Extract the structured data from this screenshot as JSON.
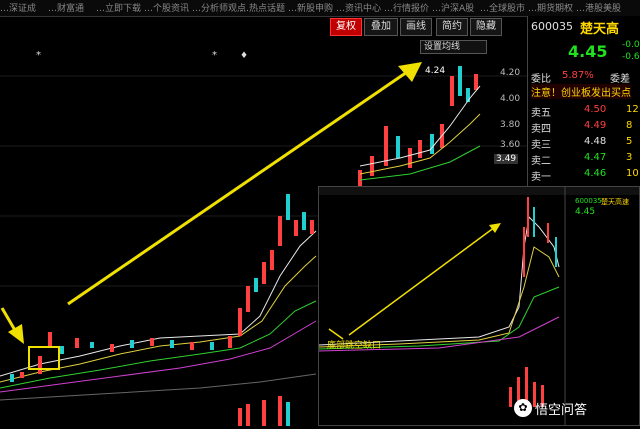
{
  "top_tabs": [
    "…深证成",
    "…财富通",
    "…立即下载",
    "…个股资讯",
    "…分析师观点",
    "…热点话题",
    "…新股申购",
    "…资讯中心",
    "…行情报价",
    "…沪深A股",
    "…全球股市",
    "…期货期权",
    "…港股美股"
  ],
  "toolbar": {
    "fuquan": "复权",
    "diejia": "叠加",
    "huaxian": "画线",
    "jianyue": "简约",
    "yincang": "隐藏"
  },
  "set_ma": "设置均线",
  "price_labels": [
    "4.20",
    "4.00",
    "3.80",
    "3.60",
    "3.49"
  ],
  "marker_price": "4.24",
  "right_panel": {
    "code": "600035",
    "name": "楚天高",
    "price": "4.45",
    "change": "-0.0",
    "change_pct": "-0.6",
    "weibi_label": "委比",
    "weibi_value": "5.87%",
    "weicha_label": "委差",
    "notice": "注意！创业板发出买点",
    "asks": [
      {
        "label": "卖五",
        "price": "4.50",
        "vol": "12"
      },
      {
        "label": "卖四",
        "price": "4.49",
        "vol": "8"
      },
      {
        "label": "卖三",
        "price": "4.48",
        "vol": "5"
      },
      {
        "label": "卖二",
        "price": "4.47",
        "vol": "3"
      },
      {
        "label": "卖一",
        "price": "4.46",
        "vol": "10"
      }
    ]
  },
  "inset": {
    "code": "600035",
    "name": "楚天高速",
    "price": "4.45",
    "annotation": "底部跳空缺口"
  },
  "watermark": "悟空问答",
  "colors": {
    "up": "#ff4040",
    "down": "#20d0d0",
    "arrow": "#f0e000",
    "bg": "#000000"
  }
}
